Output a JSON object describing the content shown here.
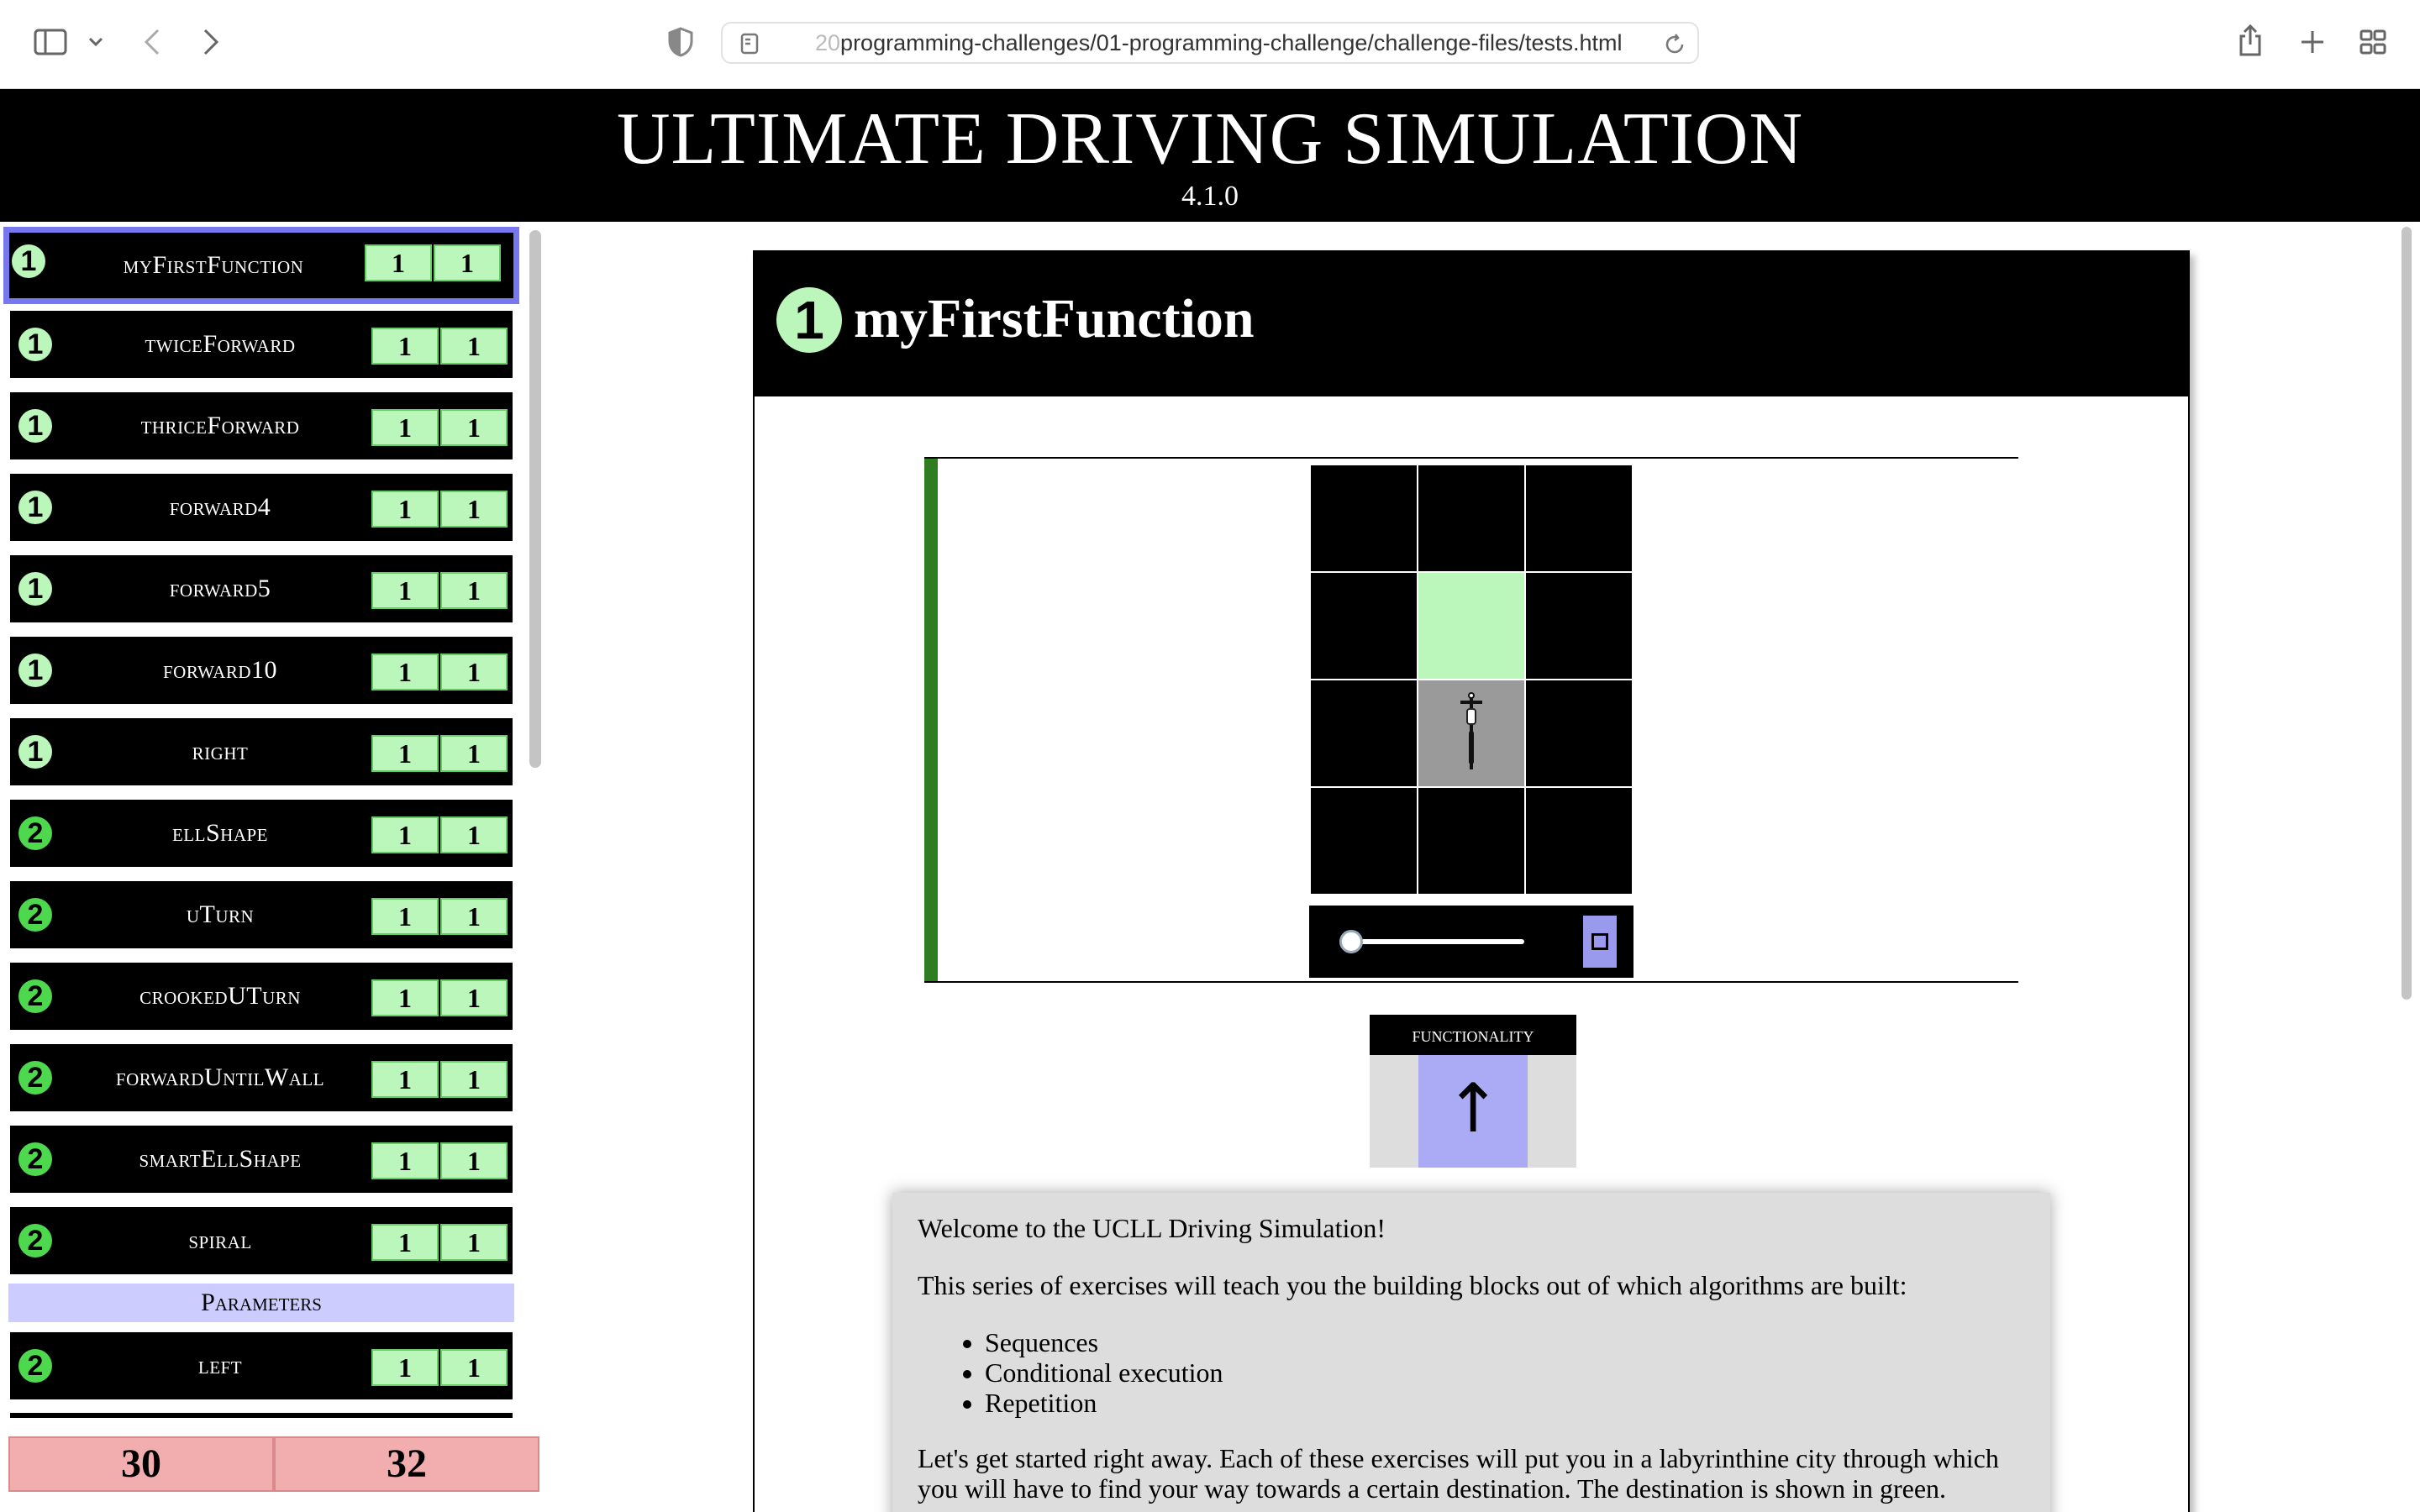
{
  "browser": {
    "url_faded": "20",
    "url_main": "programming-challenges/01-programming-challenge/challenge-files/tests.html"
  },
  "page": {
    "title": "ULTIMATE DRIVING SIMULATION",
    "version": "4.1.0"
  },
  "sidebar": {
    "exercises": [
      {
        "level": "1",
        "name": "myFirstFunction",
        "score_a": "1",
        "score_b": "1",
        "selected": true
      },
      {
        "level": "1",
        "name": "twiceForward",
        "score_a": "1",
        "score_b": "1"
      },
      {
        "level": "1",
        "name": "thriceForward",
        "score_a": "1",
        "score_b": "1"
      },
      {
        "level": "1",
        "name": "forward4",
        "score_a": "1",
        "score_b": "1"
      },
      {
        "level": "1",
        "name": "forward5",
        "score_a": "1",
        "score_b": "1"
      },
      {
        "level": "1",
        "name": "forward10",
        "score_a": "1",
        "score_b": "1"
      },
      {
        "level": "1",
        "name": "right",
        "score_a": "1",
        "score_b": "1"
      },
      {
        "level": "2",
        "name": "ellShape",
        "score_a": "1",
        "score_b": "1"
      },
      {
        "level": "2",
        "name": "uTurn",
        "score_a": "1",
        "score_b": "1"
      },
      {
        "level": "2",
        "name": "crookedUTurn",
        "score_a": "1",
        "score_b": "1"
      },
      {
        "level": "2",
        "name": "forwardUntilWall",
        "score_a": "1",
        "score_b": "1"
      },
      {
        "level": "2",
        "name": "smartEllShape",
        "score_a": "1",
        "score_b": "1"
      },
      {
        "level": "2",
        "name": "spiral",
        "score_a": "1",
        "score_b": "1"
      }
    ],
    "section_header": "Parameters",
    "param_exercise": {
      "level": "2",
      "name": "left",
      "score_a": "1",
      "score_b": "1"
    },
    "totals": {
      "a": "30",
      "b": "32"
    }
  },
  "exercise": {
    "level": "1",
    "title": "myFirstFunction",
    "functionality_label": "functionality",
    "functionality_arrow": "↑",
    "slider_value": 0,
    "description": {
      "p1": "Welcome to the UCLL Driving Simulation!",
      "p2": "This series of exercises will teach you the building blocks out of which algorithms are built:",
      "items": [
        "Sequences",
        "Conditional execution",
        "Repetition"
      ],
      "p3": "Let's get started right away. Each of these exercises will put you in a labyrinthine city through which you will have to find your way towards a certain destination. The destination is shown in green."
    }
  },
  "colors": {
    "level1_badge": "#bbf7bb",
    "level2_badge": "#4ed84e",
    "score_bg": "#bbf7bb",
    "total_bg": "#f2aeae",
    "selected_border": "#7777ee",
    "section_bg": "#ccccff",
    "goal_cell": "#bbf7bb",
    "accent_bar": "#2e7d20"
  }
}
